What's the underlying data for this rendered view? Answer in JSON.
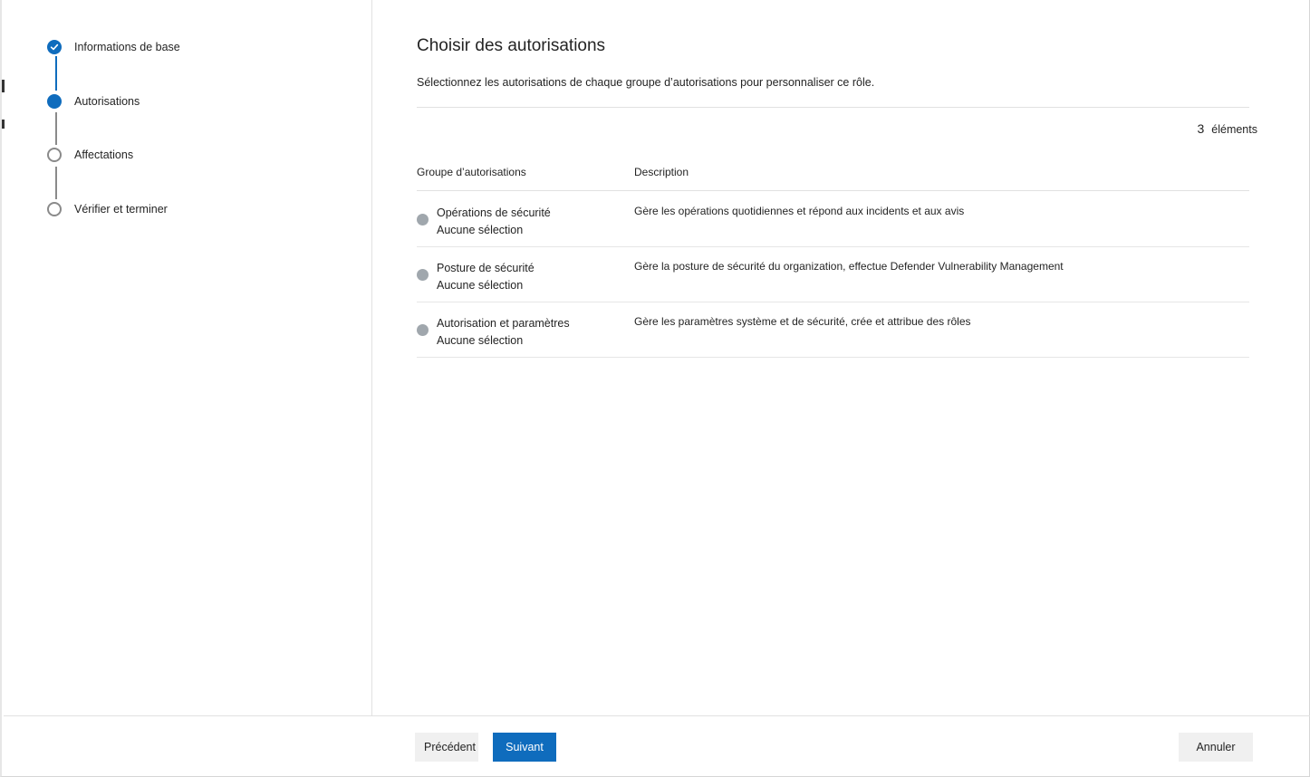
{
  "wizard": {
    "steps": [
      {
        "label": "Informations de base",
        "state": "done"
      },
      {
        "label": "Autorisations",
        "state": "current"
      },
      {
        "label": "Affectations",
        "state": "todo"
      },
      {
        "label": "Vérifier et terminer",
        "state": "todo"
      }
    ]
  },
  "main": {
    "title": "Choisir des autorisations",
    "subtitle": "Sélectionnez les autorisations de chaque groupe d’autorisations pour personnaliser ce rôle.",
    "count": {
      "number": "3",
      "label": "éléments"
    },
    "table": {
      "headers": [
        "Groupe d’autorisations",
        "Description"
      ],
      "rows": [
        {
          "name": "Opérations de sécurité",
          "selection": "Aucune sélection",
          "description": "Gère les opérations quotidiennes et répond aux incidents et aux avis"
        },
        {
          "name": "Posture de sécurité",
          "selection": "Aucune sélection",
          "description": "Gère la posture de sécurité du organization, effectue Defender Vulnerability Management"
        },
        {
          "name": "Autorisation et paramètres",
          "selection": "Aucune sélection",
          "description": "Gère les paramètres système et de sécurité, crée et attribue des rôles"
        }
      ]
    }
  },
  "footer": {
    "previous_label": "Précédent",
    "next_label": "Suivant",
    "cancel_label": "Annuler"
  },
  "colors": {
    "accent": "#0f6cbd",
    "inactive_dot": "#a0a7ad"
  },
  "icons": {
    "done_step": "checkmark-icon",
    "current_step": "filled-circle-icon",
    "todo_step": "empty-circle-icon",
    "row_status": "status-dot-icon"
  }
}
